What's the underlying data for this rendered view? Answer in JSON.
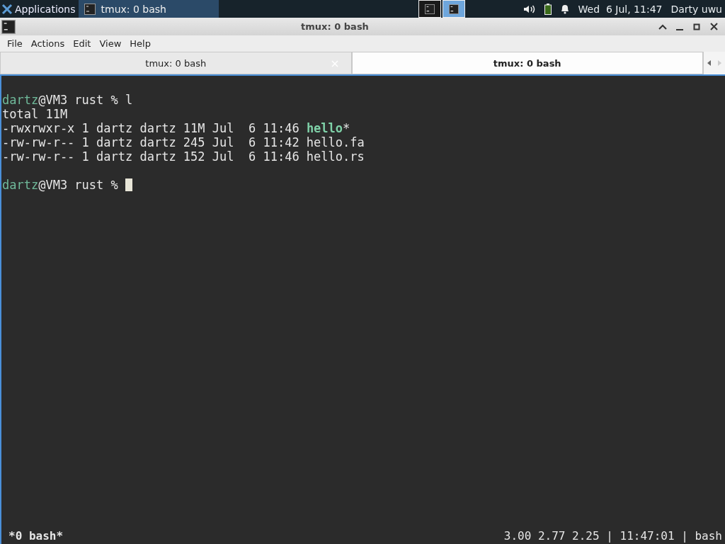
{
  "taskbar": {
    "apps_label": "Applications",
    "tasks": [
      {
        "label": "tmux: 0 bash",
        "selected": true
      }
    ],
    "workspaces": [
      {
        "selected": false
      },
      {
        "selected": true
      }
    ],
    "clock": "Wed  6 Jul, 11:47",
    "user": "Darty uwu"
  },
  "window": {
    "title": "tmux: 0 bash"
  },
  "menu": [
    "File",
    "Actions",
    "Edit",
    "View",
    "Help"
  ],
  "tabs": [
    {
      "label": "tmux: 0 bash",
      "selected": false
    },
    {
      "label": "tmux: 0 bash",
      "selected": true
    }
  ],
  "terminal": {
    "lines": [
      {
        "kind": "text",
        "cursor": false,
        "segments": [
          {
            "kind": "user",
            "text": "dartz"
          },
          {
            "kind": "plain",
            "text": "@VM3 rust % l"
          }
        ]
      },
      {
        "kind": "text",
        "cursor": false,
        "segments": [
          {
            "kind": "plain",
            "text": "total 11M"
          }
        ]
      },
      {
        "kind": "text",
        "cursor": false,
        "segments": [
          {
            "kind": "plain",
            "text": "-rwxrwxr-x 1 dartz dartz 11M Jul  6 11:46 "
          },
          {
            "kind": "exec",
            "text": "hello"
          },
          {
            "kind": "plain",
            "text": "*"
          }
        ]
      },
      {
        "kind": "text",
        "cursor": false,
        "segments": [
          {
            "kind": "plain",
            "text": "-rw-rw-r-- 1 dartz dartz 245 Jul  6 11:42 hello.fa"
          }
        ]
      },
      {
        "kind": "text",
        "cursor": false,
        "segments": [
          {
            "kind": "plain",
            "text": "-rw-rw-r-- 1 dartz dartz 152 Jul  6 11:46 hello.rs"
          }
        ]
      },
      {
        "kind": "blank"
      },
      {
        "kind": "text",
        "cursor": true,
        "segments": [
          {
            "kind": "user",
            "text": "dartz"
          },
          {
            "kind": "plain",
            "text": "@VM3 rust % "
          }
        ]
      }
    ]
  },
  "status": {
    "left": "*0 bash*",
    "right": "3.00 2.77 2.25 | 11:47:01 | bash"
  }
}
